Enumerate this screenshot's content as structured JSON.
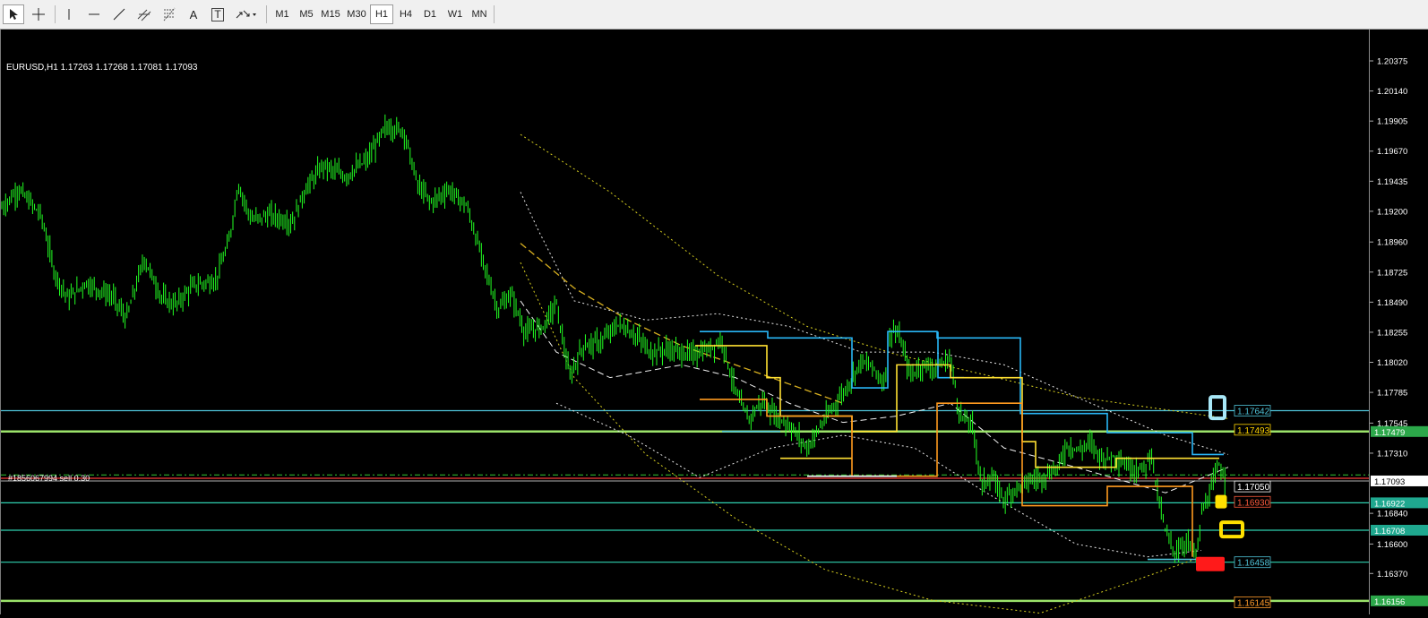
{
  "toolbar": {
    "tools": [
      "cursor-icon",
      "crosshair-icon",
      "vertical-line-icon",
      "horizontal-line-icon",
      "trendline-icon",
      "channel-icon",
      "fibonacci-icon",
      "text-icon",
      "text-label-icon",
      "arrows-icon"
    ],
    "text_tool_label": "A",
    "text_label_tool_label": "T",
    "timeframes": [
      "M1",
      "M5",
      "M15",
      "M30",
      "H1",
      "H4",
      "D1",
      "W1",
      "MN"
    ],
    "active_timeframe": "H1"
  },
  "chart": {
    "symbol_info": "EURUSD,H1  1.17263 1.17268 1.17081 1.17093",
    "order_label": "#1856067994 sell 0.30",
    "price_range": [
      1.1605,
      1.2062
    ],
    "axis_ticks": [
      "1.20375",
      "1.20140",
      "1.19905",
      "1.19670",
      "1.19435",
      "1.19200",
      "1.18960",
      "1.18725",
      "1.18490",
      "1.18255",
      "1.18020",
      "1.17785",
      "1.17545",
      "1.17310",
      "1.16840",
      "1.16600",
      "1.16370"
    ],
    "horizontal_levels": [
      {
        "price": 1.17642,
        "color": "#4fc3d8",
        "label": "1.17642",
        "label_color": "#4fc3d8"
      },
      {
        "price": 1.17479,
        "color": "#9be36a",
        "label": "1.17479",
        "label_color": "#ffffff",
        "label_bg": "#2ca84a"
      },
      {
        "price": 1.16922,
        "color": "#2fd1b0",
        "label": "1.16922",
        "label_color": "#ffffff",
        "label_bg": "#1fa88f"
      },
      {
        "price": 1.16708,
        "color": "#2fd1b0",
        "label": "1.16708",
        "label_color": "#ffffff",
        "label_bg": "#1fa88f"
      },
      {
        "price": 1.16458,
        "color": "#2fd1b0",
        "label": "1.16458",
        "label_color": "#4fc3d8"
      },
      {
        "price": 1.16156,
        "color": "#9be36a",
        "label": "1.16156",
        "label_color": "#ffffff",
        "label_bg": "#2ca84a"
      }
    ],
    "current_price": {
      "price": 1.17093,
      "label": "1.17093"
    },
    "order_price": 1.1714,
    "inline_labels": [
      {
        "price": 1.17642,
        "label": "1.17642",
        "color": "#4fc3d8"
      },
      {
        "price": 1.17493,
        "label": "1.17493",
        "color": "#ffd400"
      },
      {
        "price": 1.1705,
        "label": "1.17050",
        "color": "#ffffff"
      },
      {
        "price": 1.1693,
        "label": "1.16930",
        "color": "#ff5a3c"
      },
      {
        "price": 1.16458,
        "label": "1.16458",
        "color": "#4fc3d8"
      },
      {
        "price": 1.16145,
        "label": "1.16145",
        "color": "#ff9a2a"
      }
    ],
    "colors": {
      "candle": "#22ff22",
      "background": "#000000",
      "blue_box": "#29b6f6",
      "yellow_box": "#ffe033",
      "orange_box": "#ff9a1f"
    }
  }
}
